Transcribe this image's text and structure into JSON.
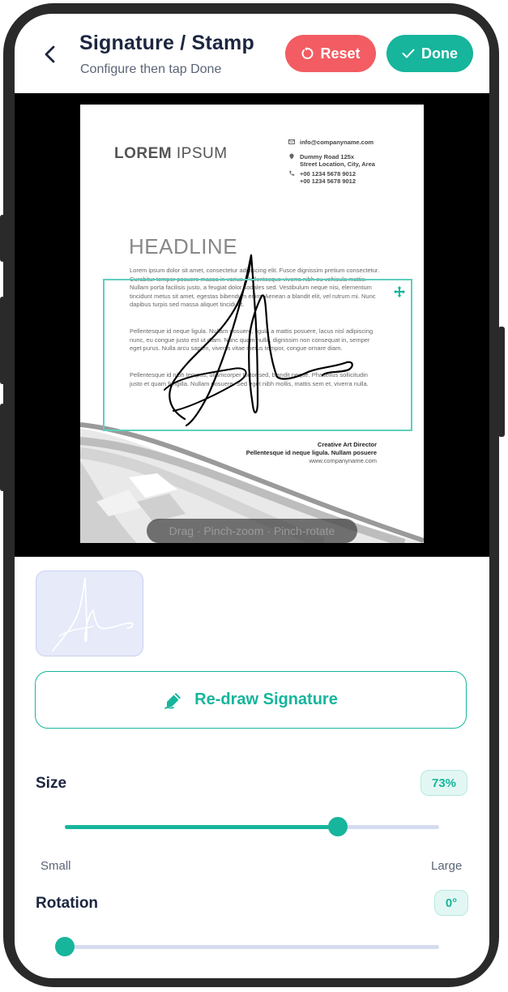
{
  "header": {
    "title": "Signature / Stamp",
    "subtitle": "Configure then tap Done",
    "reset_label": "Reset",
    "done_label": "Done"
  },
  "document": {
    "logo_bold": "LOREM",
    "logo_light": " IPSUM",
    "contact_email": "info@companyname.com",
    "contact_address_1": "Dummy Road 125x",
    "contact_address_2": "Street Location, City, Area",
    "contact_phone_1": "+00 1234 5678 9012",
    "contact_phone_2": "+00 1234 5678 9012",
    "headline": "HEADLINE",
    "paragraph_1": "Lorem ipsum dolor sit amet, consectetur adipiscing elit. Fusce dignissim pretium consectetur. Curabitur tempor posuere massa in varius. Pellentesque viverra nibh eu vehicula mattis. Nullam porta facilisis justo, a feugiat dolor sodales sed. Vestibulum neque nisi, elementum tincidunt metus sit amet, egestas bibendum enim. Aenean a blandit elit, vel rutrum mi. Nunc dapibus turpis sed massa aliquet tincidunt.",
    "paragraph_2": "Pellentesque id neque ligula. Nullam posuere, ligula a mattis posuere, lacus nisl adipiscing nunc, eu congue justo est ut diam. Nunc quam nulla, dignissim non consequat in, semper eget purus. Nulla arcu sapien, viverra vitae metus tempor, congue ornare diam.",
    "paragraph_3": "Pellentesque id nibh tempus, ullamcorper tortor sed, blandit neque. Phasellus sollicitudin justo et quam fringilla. Nullam posuere. Sed eget nibh mollis, mattis sem et, viverra nulla.",
    "sign_title": "Creative Art Director",
    "sign_line": "Pellentesque id neque ligula. Nullam posuere",
    "sign_web": "www.companyname.com"
  },
  "preview": {
    "gesture_hint": "Drag · Pinch-zoom · Pinch-rotate"
  },
  "redraw_label": "Re-draw Signature",
  "size": {
    "label": "Size",
    "value_label": "73%",
    "value": 0.73,
    "min_label": "Small",
    "max_label": "Large"
  },
  "rotation": {
    "label": "Rotation",
    "value_label": "0°",
    "value": 0
  },
  "colors": {
    "accent": "#16b59c",
    "danger": "#f25c62",
    "title": "#1c2640"
  },
  "icons": {
    "back": "chevron-left-icon",
    "reset": "refresh-icon",
    "done": "check-icon",
    "move": "move-icon",
    "redraw": "pen-edit-icon"
  }
}
